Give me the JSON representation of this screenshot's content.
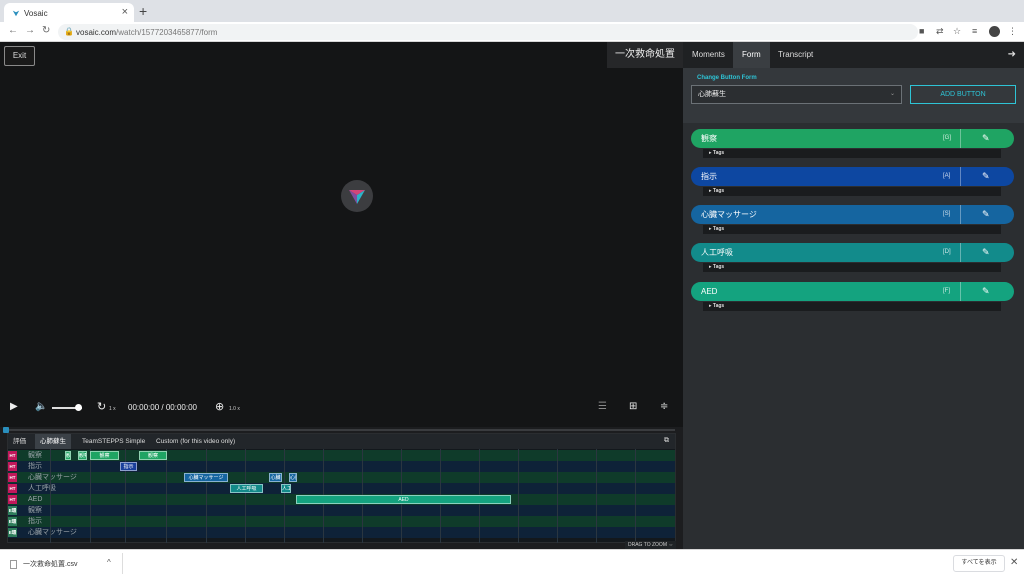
{
  "browser": {
    "tab_title": "Vosaic",
    "url_host": "vosaic.com",
    "url_path": "/watch/1577203465877/form"
  },
  "player": {
    "exit_label": "Exit",
    "video_title": "一次救命処置",
    "time_current": "00:00:00",
    "time_total": "/ 00:00:00",
    "rewind_speed": "1 x",
    "zoom_level": "1.0 x",
    "volume_level": 0.75
  },
  "timeline": {
    "tabs": [
      "評価",
      "心肺蘇生",
      "TeamSTEPPS Simple",
      "Custom (for this video only)"
    ],
    "active_tab": 1,
    "drag_to_zoom": "DRAG TO ZOOM",
    "rows": [
      {
        "badge": "HT",
        "badge_color": "#c2185b",
        "label": "観察"
      },
      {
        "badge": "HT",
        "badge_color": "#c2185b",
        "label": "指示"
      },
      {
        "badge": "HT",
        "badge_color": "#c2185b",
        "label": "心臓マッサージ"
      },
      {
        "badge": "HT",
        "badge_color": "#c2185b",
        "label": "人工呼吸"
      },
      {
        "badge": "HT",
        "badge_color": "#c2185b",
        "label": "AED"
      },
      {
        "badge": "E環",
        "badge_color": "#2e7d5b",
        "label": "観察"
      },
      {
        "badge": "E環",
        "badge_color": "#2e7d5b",
        "label": "指示"
      },
      {
        "badge": "E環",
        "badge_color": "#2e7d5b",
        "label": "心臓マッサージ"
      }
    ],
    "segments": [
      {
        "row": 0,
        "label": "観",
        "color": "#1fa463"
      },
      {
        "row": 0,
        "label": "観察",
        "color": "#1fa463"
      },
      {
        "row": 0,
        "label": "観察",
        "color": "#1fa463"
      },
      {
        "row": 0,
        "label": "観察",
        "color": "#1fa463"
      },
      {
        "row": 1,
        "label": "指示",
        "color": "#1a3f9c"
      },
      {
        "row": 2,
        "label": "心臓マッサージ",
        "color": "#1565a0"
      },
      {
        "row": 2,
        "label": "心臓",
        "color": "#1565a0"
      },
      {
        "row": 2,
        "label": "心臓",
        "color": "#1565a0"
      },
      {
        "row": 3,
        "label": "人工呼吸",
        "color": "#138a8a"
      },
      {
        "row": 3,
        "label": "人工",
        "color": "#138a8a"
      },
      {
        "row": 4,
        "label": "AED",
        "color": "#14a37f"
      }
    ]
  },
  "panel": {
    "tabs": [
      "Moments",
      "Form",
      "Transcript"
    ],
    "active_tab": 1,
    "change_form_label": "Change Button Form",
    "form_select_value": "心肺蘇生",
    "add_button_label": "ADD BUTTON",
    "buttons": [
      {
        "label": "観察",
        "key": "[G]",
        "color": "#1fa463",
        "tags": "Tags"
      },
      {
        "label": "指示",
        "key": "[A]",
        "color": "#0d47a1",
        "tags": "Tags"
      },
      {
        "label": "心臓マッサージ",
        "key": "[S]",
        "color": "#1565a0",
        "tags": "Tags"
      },
      {
        "label": "人工呼吸",
        "key": "[D]",
        "color": "#128b8b",
        "tags": "Tags"
      },
      {
        "label": "AED",
        "key": "[F]",
        "color": "#14a37f",
        "tags": "Tags"
      }
    ]
  },
  "downloads": {
    "file_name": "一次救命処置.csv",
    "show_all_label": "すべてを表示"
  },
  "colors": {
    "accent": "#2ec4d6",
    "scrub": "#2a8fbd"
  }
}
